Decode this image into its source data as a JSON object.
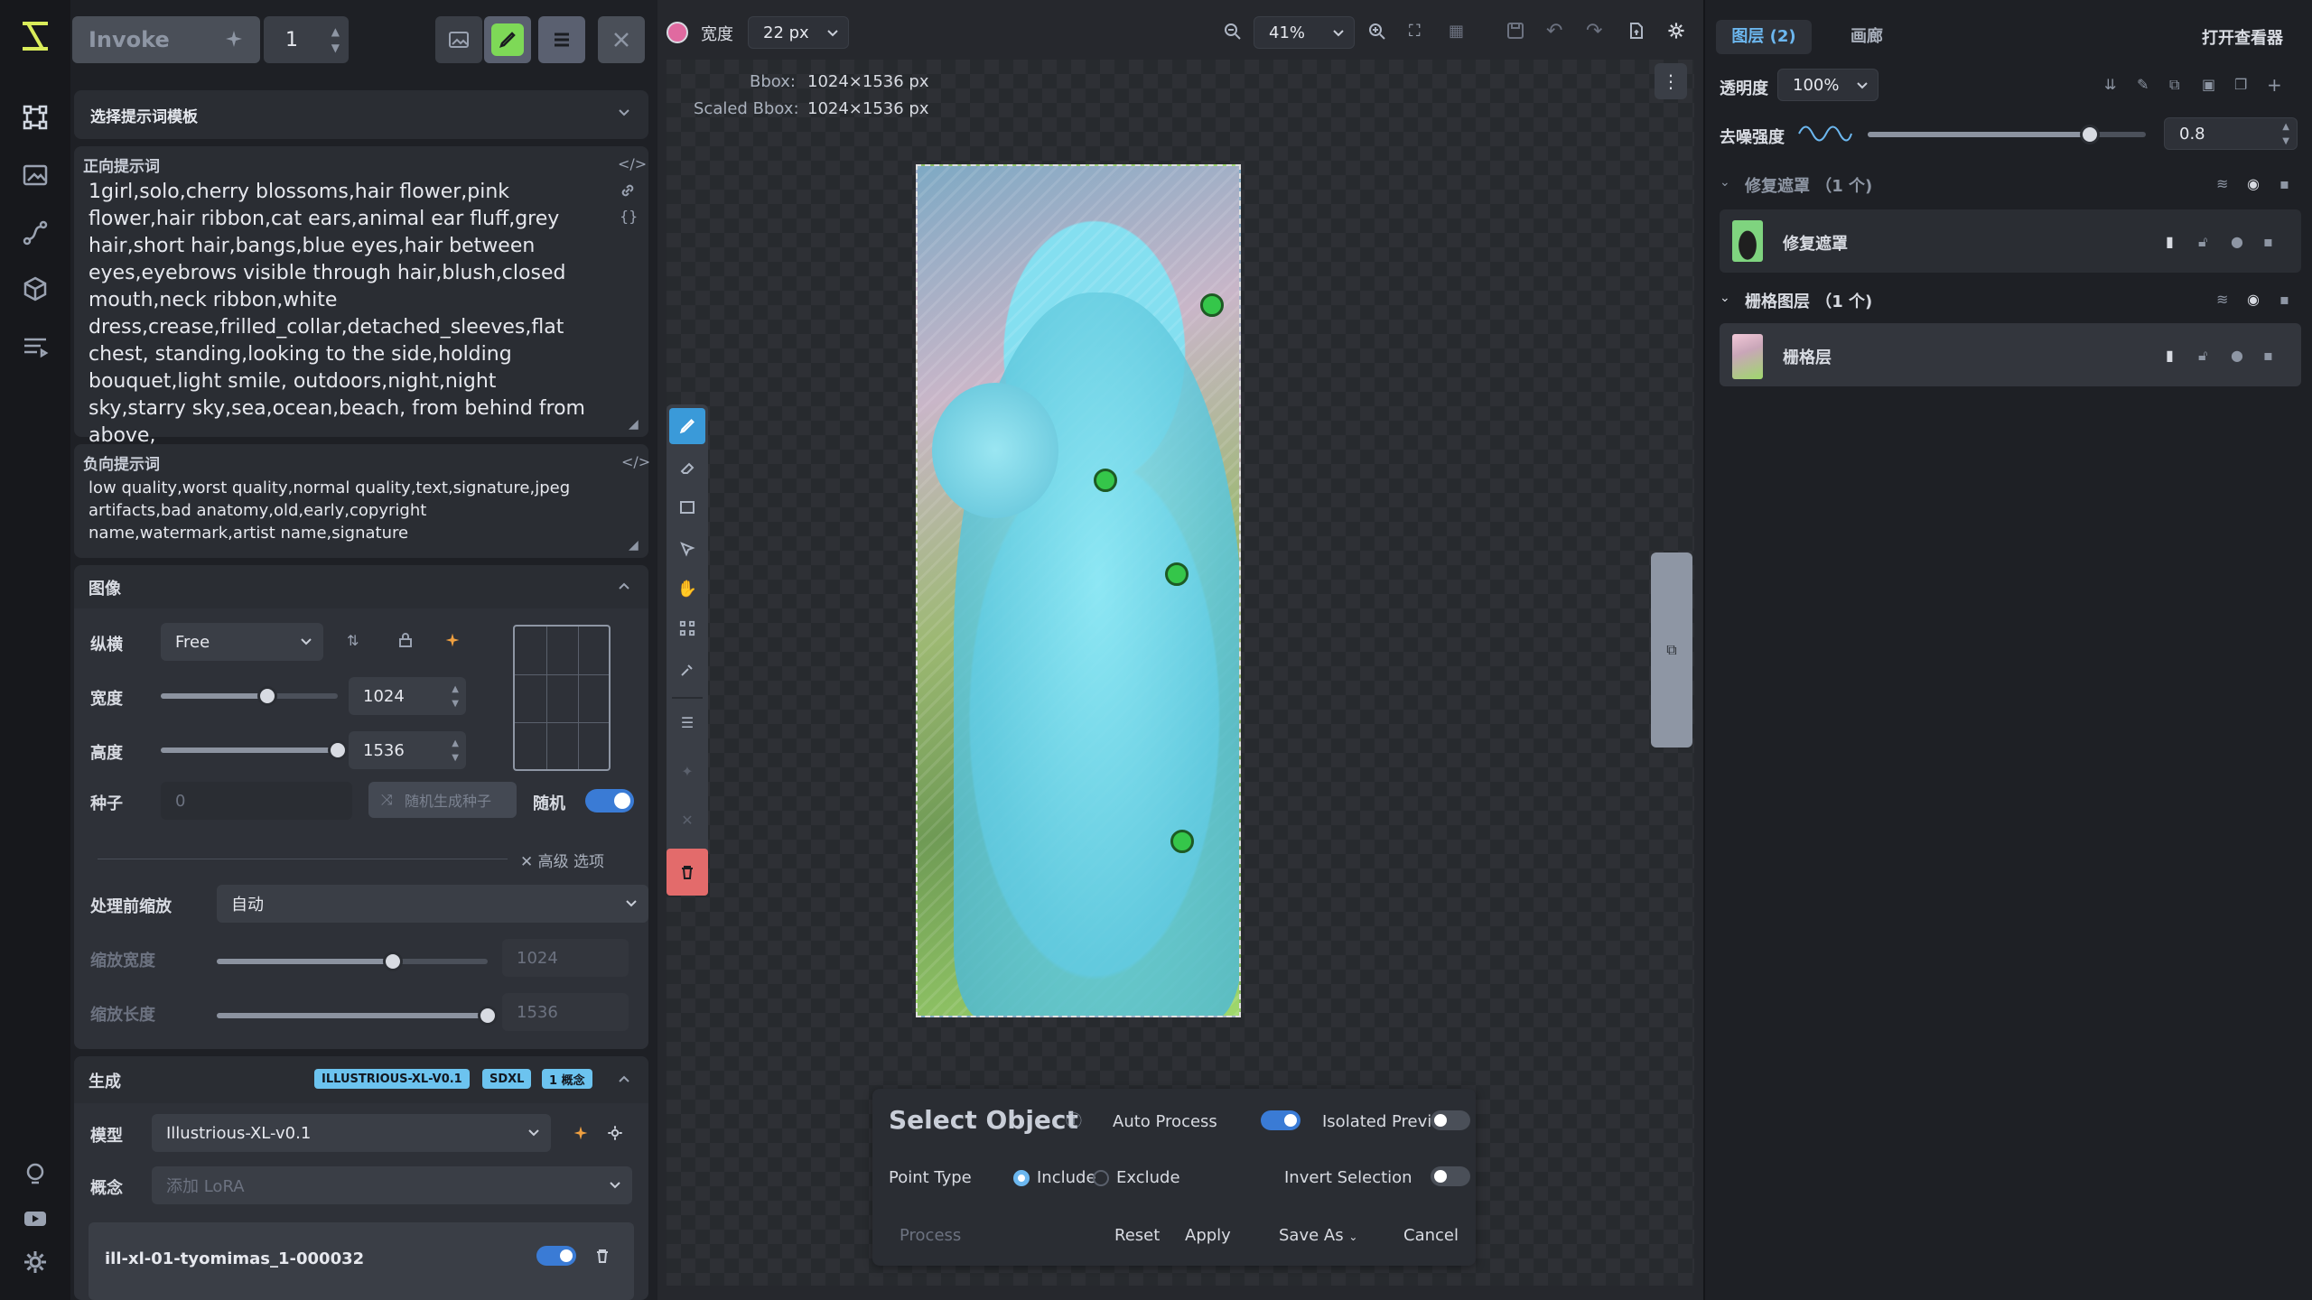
{
  "app": {
    "brand_icon": "invoke-logo"
  },
  "rail": {
    "items": [
      "canvas-workflow-icon",
      "image-icon",
      "nodes-icon",
      "models-icon",
      "queue-icon"
    ],
    "bottom": [
      "bulb-icon",
      "youtube-icon",
      "settings-icon"
    ]
  },
  "top_left": {
    "invoke_label": "Invoke",
    "batch_count": "1"
  },
  "prompt_template": {
    "label": "选择提示词模板"
  },
  "positive": {
    "label": "正向提示词",
    "text": "1girl,solo,cherry blossoms,hair flower,pink flower,hair ribbon,cat ears,animal ear fluff,grey hair,short hair,bangs,blue eyes,hair between eyes,eyebrows visible through hair,blush,closed mouth,neck ribbon,white dress,crease,frilled_collar,detached_sleeves,flat chest, standing,looking to the side,holding bouquet,light smile, outdoors,night,night sky,starry sky,sea,ocean,beach, from behind from above,"
  },
  "negative": {
    "label": "负向提示词",
    "text": "low quality,worst quality,normal quality,text,signature,jpeg artifacts,bad anatomy,old,early,copyright name,watermark,artist name,signature"
  },
  "image_section": {
    "title": "图像",
    "aspect_label": "纵横",
    "aspect_value": "Free",
    "width_label": "宽度",
    "width_value": "1024",
    "width_fraction": 0.6,
    "height_label": "高度",
    "height_value": "1536",
    "height_fraction": 1.0,
    "seed_label": "种子",
    "seed_value": "0",
    "random_seed_button": "随机生成种子",
    "random_label": "随机",
    "advanced_label": "高级 选项",
    "prescale_label": "处理前缩放",
    "prescale_value": "自动",
    "scaled_width_label": "缩放宽度",
    "scaled_width_value": "1024",
    "scaled_width_fraction": 0.65,
    "scaled_height_label": "缩放长度",
    "scaled_height_value": "1536",
    "scaled_height_fraction": 1.0
  },
  "generation": {
    "title": "生成",
    "badges": [
      "ILLUSTRIOUS-XL-V0.1",
      "SDXL",
      "1 概念"
    ],
    "model_label": "模型",
    "model_value": "Illustrious-XL-v0.1",
    "concept_label": "概念",
    "concept_placeholder": "添加 LoRA",
    "lora_name": "ill-xl-01-tyomimas_1-000032"
  },
  "canvas_toolbar": {
    "width_label": "宽度",
    "brush_size": "22 px",
    "zoom": "41%",
    "brush_color": "#e06aa0"
  },
  "bbox": {
    "label1": "Bbox:",
    "value1": "1024×1536 px",
    "label2": "Scaled Bbox:",
    "value2": "1024×1536 px"
  },
  "select_object": {
    "title": "Select Object",
    "auto_process": "Auto Process",
    "isolated_preview": "Isolated Preview",
    "point_type": "Point Type",
    "include": "Include",
    "exclude": "Exclude",
    "invert_selection": "Invert Selection",
    "process": "Process",
    "reset": "Reset",
    "apply": "Apply",
    "save_as": "Save As",
    "cancel": "Cancel"
  },
  "right": {
    "tabs": [
      "图层 (2)",
      "画廊"
    ],
    "open_viewer": "打开查看器",
    "opacity_label": "透明度",
    "opacity_value": "100%",
    "denoise_label": "去噪强度",
    "denoise_value": "0.8",
    "denoise_fraction": 0.8,
    "inpaint_group": "修复遮罩 （1 个)",
    "inpaint_layer": "修复遮罩",
    "raster_group": "栅格图层 （1 个)",
    "raster_layer": "栅格层"
  }
}
